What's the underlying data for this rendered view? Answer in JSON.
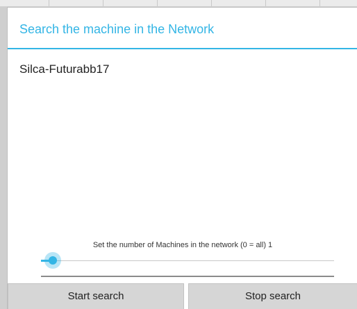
{
  "dialog": {
    "title": "Search the machine in the Network"
  },
  "machines": {
    "items": [
      "Silca-Futurabb17"
    ]
  },
  "slider": {
    "label": "Set the number of Machines in the network (0 = all) 1",
    "value": 1,
    "fraction": 0.03
  },
  "buttons": {
    "start": "Start search",
    "stop": "Stop search"
  },
  "colors": {
    "accent": "#33b5e5",
    "background": "#ffffff",
    "button": "#d6d6d6"
  }
}
